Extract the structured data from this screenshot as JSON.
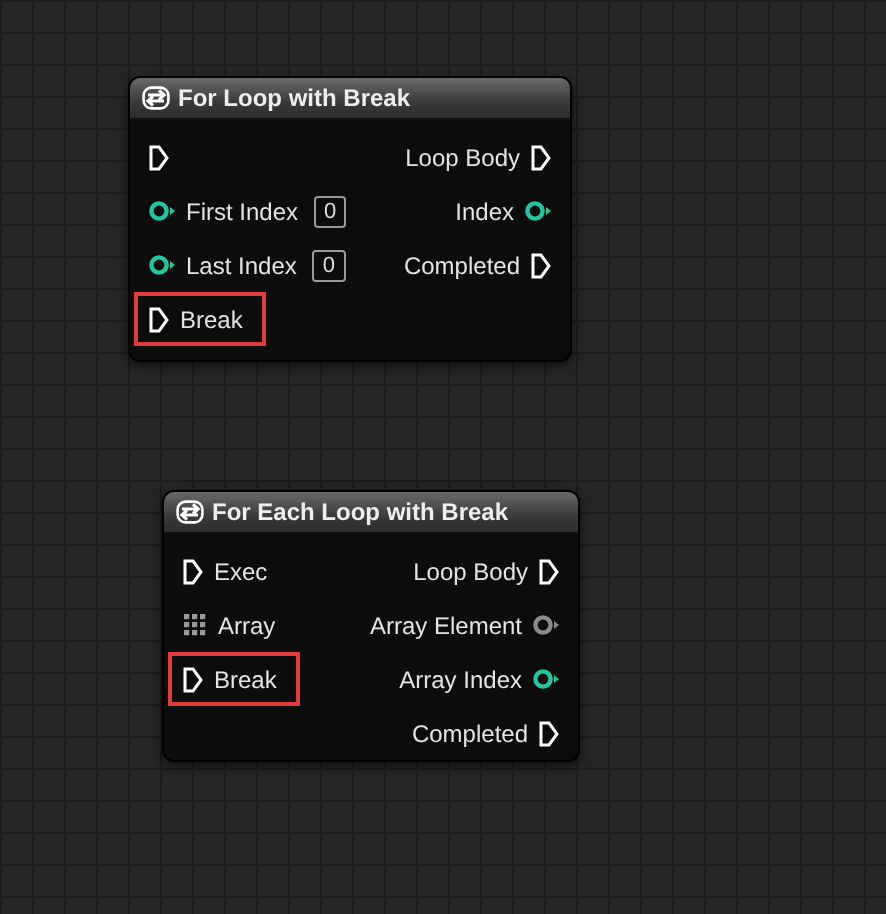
{
  "nodes": [
    {
      "title": "For Loop with Break",
      "inputs": [
        {
          "kind": "exec",
          "highlighted": false
        },
        {
          "kind": "data",
          "label": "First Index",
          "default": "0",
          "color": "#1fc7a0",
          "highlighted": false
        },
        {
          "kind": "data",
          "label": "Last Index",
          "default": "0",
          "color": "#1fc7a0",
          "highlighted": false
        },
        {
          "kind": "exec",
          "label": "Break",
          "highlighted": true
        }
      ],
      "outputs": [
        {
          "kind": "exec",
          "label": "Loop Body"
        },
        {
          "kind": "data",
          "label": "Index",
          "color": "#1fc7a0"
        },
        {
          "kind": "exec",
          "label": "Completed"
        }
      ]
    },
    {
      "title": "For Each Loop with Break",
      "inputs": [
        {
          "kind": "exec",
          "label": "Exec",
          "highlighted": false
        },
        {
          "kind": "array",
          "label": "Array",
          "highlighted": false
        },
        {
          "kind": "exec",
          "label": "Break",
          "highlighted": true
        }
      ],
      "outputs": [
        {
          "kind": "exec",
          "label": "Loop Body"
        },
        {
          "kind": "data",
          "label": "Array Element",
          "color": "#8a8a8a"
        },
        {
          "kind": "data",
          "label": "Array Index",
          "color": "#1fc7a0"
        },
        {
          "kind": "exec",
          "label": "Completed"
        }
      ]
    }
  ]
}
